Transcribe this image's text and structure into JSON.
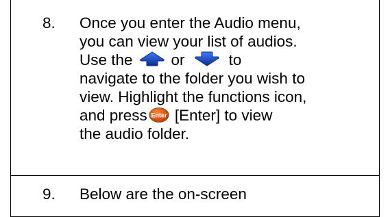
{
  "colors": {
    "icon_blue": "#1a4fd6",
    "icon_dark": "#0a2c8a",
    "enter_fill": "#d94a0a",
    "enter_text": "#ffffff"
  },
  "steps": [
    {
      "number": "8.",
      "lines": {
        "l1": "Once you enter the Audio menu,",
        "l2": "you can view your list of audios.",
        "l3_a": "Use the",
        "l3_b": "or",
        "l3_c": "to",
        "l4": "navigate to the folder you wish to",
        "l5": "view. Highlight the functions icon,",
        "l6_a": "and press",
        "l6_b": "[Enter] to view",
        "l7": "the audio folder."
      },
      "icons": {
        "up": "up-arrow-button-icon",
        "down": "down-arrow-button-icon",
        "enter": "enter-button-icon",
        "enter_label": "Enter"
      }
    },
    {
      "number": "9.",
      "lines": {
        "l1": "Below are the on-screen"
      }
    }
  ]
}
